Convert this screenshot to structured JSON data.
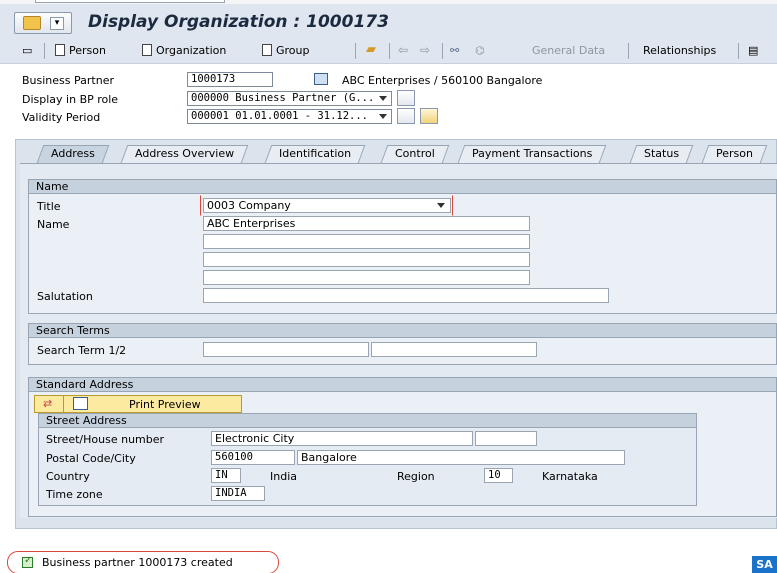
{
  "window": {
    "title": "Display Organization : 1000173"
  },
  "toolbar": {
    "person_label": "Person",
    "organization_label": "Organization",
    "group_label": "Group",
    "general_data_label": "General Data",
    "relationships_label": "Relationships"
  },
  "header": {
    "business_partner_label": "Business Partner",
    "business_partner_value": "1000173",
    "business_partner_desc": "ABC Enterprises / 560100 Bangalore",
    "bp_role_label": "Display in BP role",
    "bp_role_value": "000000 Business Partner (G...",
    "validity_label": "Validity Period",
    "validity_value": "000001 01.01.0001 - 31.12..."
  },
  "tabs": [
    {
      "label": "Address",
      "active": true
    },
    {
      "label": "Address Overview"
    },
    {
      "label": "Identification"
    },
    {
      "label": "Control"
    },
    {
      "label": "Payment Transactions"
    },
    {
      "label": "Status"
    },
    {
      "label": "Person"
    }
  ],
  "name_group": {
    "title": "Name",
    "title_label": "Title",
    "title_value": "0003 Company",
    "name_label": "Name",
    "name_value": "ABC Enterprises",
    "salutation_label": "Salutation"
  },
  "search_group": {
    "title": "Search Terms",
    "term_label": "Search Term 1/2"
  },
  "address_group": {
    "title": "Standard Address",
    "print_preview_label": "Print Preview",
    "street_title": "Street Address",
    "street_label": "Street/House number",
    "street_value": "Electronic City",
    "postal_label": "Postal Code/City",
    "postal_value": "560100",
    "city_value": "Bangalore",
    "country_label": "Country",
    "country_code": "IN",
    "country_name": "India",
    "region_label": "Region",
    "region_code": "10",
    "region_name": "Karnataka",
    "timezone_label": "Time zone",
    "timezone_value": "INDIA"
  },
  "status": {
    "message": "Business partner 1000173 created"
  },
  "brand": {
    "logo_text": "SA"
  },
  "colors": {
    "status_highlight": "#d9483b",
    "tab_bg": "#dbe3ec",
    "group_header": "#c6d1de"
  }
}
